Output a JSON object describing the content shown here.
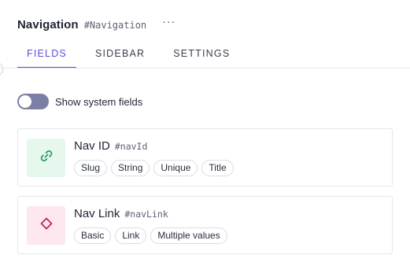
{
  "header": {
    "title": "Navigation",
    "api_id": "#Navigation",
    "more_label": "···"
  },
  "tabs": [
    {
      "label": "FIELDS",
      "active": true
    },
    {
      "label": "SIDEBAR",
      "active": false
    },
    {
      "label": "SETTINGS",
      "active": false
    }
  ],
  "toggle": {
    "label": "Show system fields",
    "on": false
  },
  "fields": [
    {
      "name": "Nav ID",
      "api_id": "#navId",
      "icon": "link-icon",
      "badges": [
        "Slug",
        "String",
        "Unique",
        "Title"
      ]
    },
    {
      "name": "Nav Link",
      "api_id": "#navLink",
      "icon": "diamond-icon",
      "badges": [
        "Basic",
        "Link",
        "Multiple values"
      ]
    }
  ],
  "colors": {
    "accent": "#5b4fd8",
    "toggle_track": "#7a7fa3",
    "link_icon": "#2e9a62",
    "link_icon_bg": "#e6f7ee",
    "diamond_icon": "#c0245c",
    "diamond_icon_bg": "#fde8ef"
  }
}
